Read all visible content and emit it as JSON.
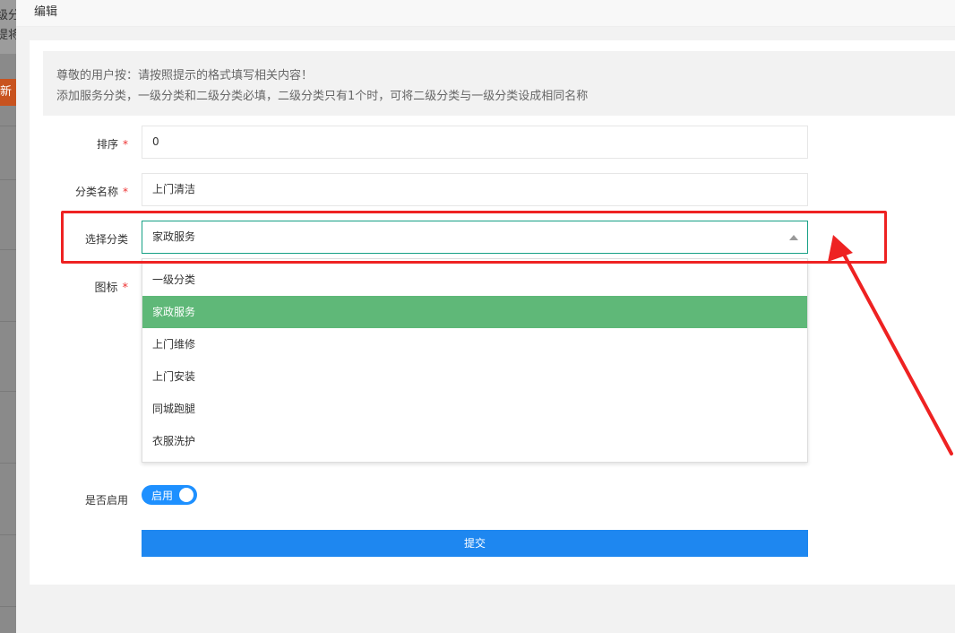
{
  "background": {
    "text1": "级分",
    "text2": "提将",
    "button": "新"
  },
  "modal": {
    "title": "编辑"
  },
  "notice": {
    "line1": "尊敬的用户按：请按照提示的格式填写相关内容！",
    "line2": "添加服务分类，一级分类和二级分类必填，二级分类只有1个时，可将二级分类与一级分类设成相同名称"
  },
  "form": {
    "sort": {
      "label": "排序",
      "value": "0"
    },
    "name": {
      "label": "分类名称",
      "value": "上门清洁"
    },
    "category": {
      "label": "选择分类",
      "value": "家政服务",
      "options": [
        "一级分类",
        "家政服务",
        "上门维修",
        "上门安装",
        "同城跑腿",
        "衣服洗护"
      ],
      "selected_index": 1
    },
    "icon": {
      "label": "图标"
    },
    "enabled": {
      "label": "是否启用",
      "switch_text": "启用",
      "on": true
    },
    "submit_label": "提交"
  },
  "colors": {
    "accent": "#1e87f0",
    "selected_option": "#5fb878",
    "required": "#ee3333",
    "annotation": "#ee2222"
  }
}
